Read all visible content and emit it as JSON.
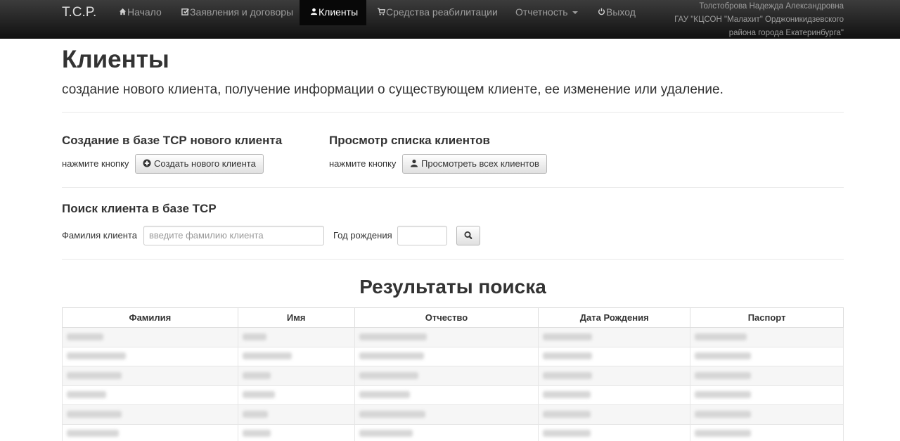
{
  "navbar": {
    "brand": "T.C.P.",
    "items": [
      {
        "label": "Начало",
        "icon": "home-icon"
      },
      {
        "label": "Заявления и договоры",
        "icon": "edit-icon"
      },
      {
        "label": "Клиенты",
        "icon": "user-icon",
        "active": true
      },
      {
        "label": "Средства реабилитации",
        "icon": "cart-icon"
      },
      {
        "label": "Отчетность",
        "icon": "",
        "dropdown": true
      },
      {
        "label": "Выход",
        "icon": "power-icon"
      }
    ],
    "user_lines": [
      "Толстоброва Надежда Александровна",
      "ГАУ \"КЦСОН \"Малахит\" Орджоникидзевского",
      "района города Екатеринбурга\""
    ]
  },
  "header": {
    "title": "Клиенты",
    "lead": "создание нового клиента, получение информации о существующем клиенте, ее изменение или удаление."
  },
  "create_section": {
    "heading": "Создание в базе ТСР нового клиента",
    "hint": "нажмите кнопку",
    "button_label": "Создать нового клиента"
  },
  "list_section": {
    "heading": "Просмотр списка клиентов",
    "hint": "нажмите кнопку",
    "button_label": "Просмотреть всех клиентов"
  },
  "search_section": {
    "heading": "Поиск клиента в базе ТСР",
    "surname_label": "Фамилия клиента",
    "surname_placeholder": "введите фамилию клиента",
    "birth_year_label": "Год рождения",
    "birth_year_value": ""
  },
  "results": {
    "title": "Результаты поиска",
    "columns": [
      "Фамилия",
      "Имя",
      "Отчество",
      "Дата Рождения",
      "Паспорт"
    ],
    "rows_note_blurred": true,
    "row_count_visible": 6
  },
  "colors": {
    "navbar_bg": "#222222",
    "active_nav_bg": "#080808",
    "text": "#333333"
  }
}
